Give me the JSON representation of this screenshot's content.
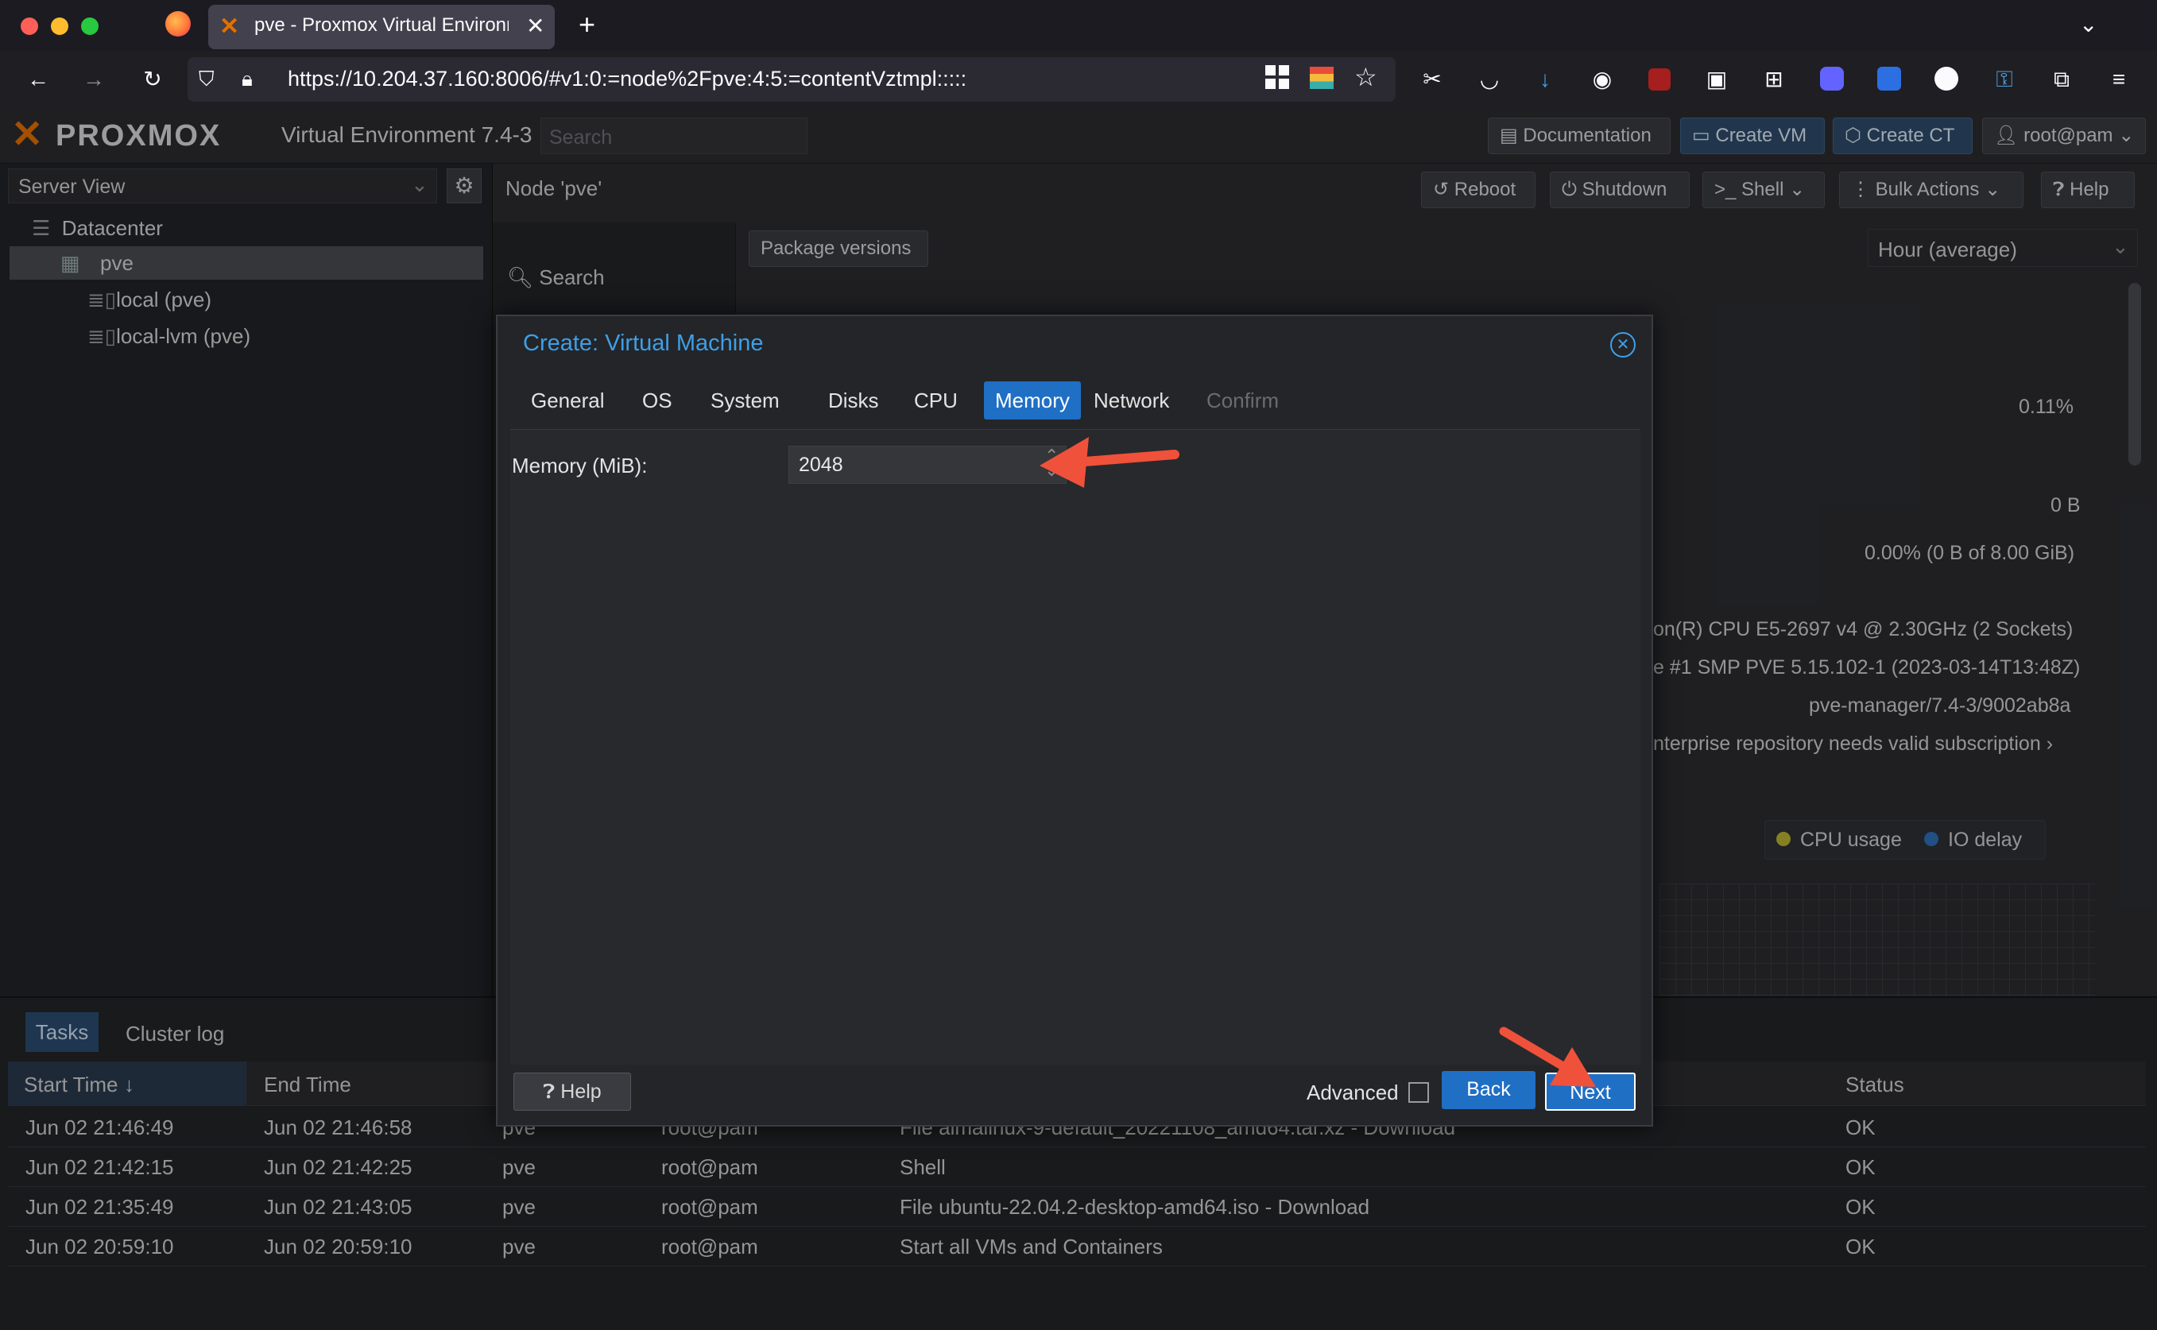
{
  "browser": {
    "tab_title": "pve - Proxmox Virtual Environme",
    "new_tab": "+",
    "url": "https://10.204.37.160:8006/#v1:0:=node%2Fpve:4:5:=contentVztmpl:::::"
  },
  "header": {
    "logo_text": "PROXMOX",
    "product": "Virtual Environment 7.4-3",
    "search_placeholder": "Search",
    "documentation": "Documentation",
    "create_vm": "Create VM",
    "create_ct": "Create CT",
    "user": "root@pam"
  },
  "left": {
    "view": "Server View",
    "tree": [
      "Datacenter",
      "pve",
      "local (pve)",
      "local-lvm (pve)"
    ]
  },
  "node_toolbar": {
    "title": "Node 'pve'",
    "reboot": "Reboot",
    "shutdown": "Shutdown",
    "shell": "Shell",
    "bulk": "Bulk Actions",
    "help": "Help"
  },
  "content": {
    "search_label": "Search",
    "package_versions": "Package versions",
    "timeframe": "Hour (average)",
    "cpu_pct": "0.11%",
    "io": "0 B",
    "storage": "0.00% (0 B of 8.00 GiB)",
    "cpu_model": "on(R) CPU E5-2697 v4 @ 2.30GHz (2 Sockets)",
    "kernel": "e #1 SMP PVE 5.15.102-1 (2023-03-14T13:48Z)",
    "manager": "pve-manager/7.4-3/9002ab8a",
    "repo": "nterprise repository needs valid subscription",
    "legend_cpu": "CPU usage",
    "legend_io": "IO delay"
  },
  "dialog": {
    "title": "Create: Virtual Machine",
    "tabs": [
      "General",
      "OS",
      "System",
      "Disks",
      "CPU",
      "Memory",
      "Network",
      "Confirm"
    ],
    "memory_label": "Memory (MiB):",
    "memory_value": "2048",
    "help": "Help",
    "advanced": "Advanced",
    "back": "Back",
    "next": "Next"
  },
  "tasks": {
    "tab_tasks": "Tasks",
    "tab_cluster": "Cluster log",
    "columns": [
      "Start Time",
      "End Time",
      "Status"
    ],
    "rows": [
      {
        "start": "Jun 02 21:46:49",
        "end": "Jun 02 21:46:58",
        "node": "pve",
        "user": "root@pam",
        "desc": "File almalinux-9-default_20221108_amd64.tar.xz - Download",
        "status": "OK"
      },
      {
        "start": "Jun 02 21:42:15",
        "end": "Jun 02 21:42:25",
        "node": "pve",
        "user": "root@pam",
        "desc": "Shell",
        "status": "OK"
      },
      {
        "start": "Jun 02 21:35:49",
        "end": "Jun 02 21:43:05",
        "node": "pve",
        "user": "root@pam",
        "desc": "File ubuntu-22.04.2-desktop-amd64.iso - Download",
        "status": "OK"
      },
      {
        "start": "Jun 02 20:59:10",
        "end": "Jun 02 20:59:10",
        "node": "pve",
        "user": "root@pam",
        "desc": "Start all VMs and Containers",
        "status": "OK"
      }
    ]
  },
  "colors": {
    "accent": "#1f6fc5",
    "title_blue": "#3d9fe8",
    "annotation": "#f0513a"
  },
  "icons": [
    "firefox-icon",
    "proxmox-icon",
    "close-icon",
    "back-icon",
    "forward-icon",
    "reload-icon",
    "shield-icon",
    "lock-icon",
    "star-icon",
    "download-icon",
    "gear-icon",
    "search-icon",
    "reboot-icon",
    "power-icon",
    "terminal-icon",
    "help-icon",
    "monitor-icon",
    "cube-icon",
    "user-icon",
    "datacenter-icon",
    "server-icon",
    "storage-icon",
    "close-circle-icon",
    "arrow-annotation"
  ]
}
